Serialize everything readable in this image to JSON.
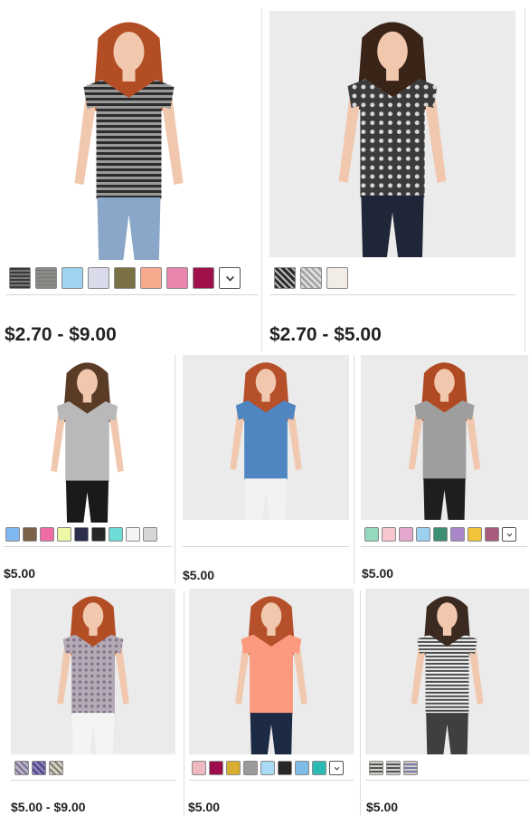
{
  "products": [
    {
      "id": "p1",
      "price": "$2.70 - $9.00",
      "swatches": [
        {
          "color": "#3a3a3a",
          "pattern": "stripe",
          "stripe": "#777"
        },
        {
          "color": "#8c8a86",
          "pattern": "heather",
          "stripe": "#777"
        },
        {
          "color": "#9fd3ef"
        },
        {
          "color": "#d9dbeb"
        },
        {
          "color": "#7a7145"
        },
        {
          "color": "#f7a98e"
        },
        {
          "color": "#ea86ad"
        },
        {
          "color": "#a0114b"
        }
      ],
      "more": true
    },
    {
      "id": "p2",
      "price": "$2.70 - $5.00",
      "swatches": [
        {
          "color": "#2a2a2a",
          "pattern": "pattern",
          "stripe": "#bbb"
        },
        {
          "color": "#dcdcdc",
          "pattern": "pattern",
          "stripe": "#9a9a9a"
        },
        {
          "color": "#f1ede6"
        }
      ],
      "more": false
    },
    {
      "id": "p3",
      "price": "$5.00",
      "swatches": [
        {
          "color": "#7fb8f0"
        },
        {
          "color": "#7b6147"
        },
        {
          "color": "#f06ca4"
        },
        {
          "color": "#eef7a5"
        },
        {
          "color": "#2b2d4a"
        },
        {
          "color": "#272727"
        },
        {
          "color": "#6bdcd6"
        },
        {
          "color": "#f4f4f4"
        },
        {
          "color": "#d6d6d6"
        }
      ],
      "more": false
    },
    {
      "id": "p4",
      "price": "$5.00",
      "swatches": [],
      "more": false
    },
    {
      "id": "p5",
      "price": "$5.00",
      "swatches": [
        {
          "color": "#94d9bd"
        },
        {
          "color": "#f7c6cf"
        },
        {
          "color": "#e4a8cc"
        },
        {
          "color": "#9bd0ee"
        },
        {
          "color": "#3c8f74"
        },
        {
          "color": "#a987c9"
        },
        {
          "color": "#f0c33a"
        },
        {
          "color": "#a85b7c"
        }
      ],
      "more": true
    },
    {
      "id": "p6",
      "price": "$5.00 - $9.00",
      "swatches": [
        {
          "color": "#b9b3c9",
          "pattern": "pattern",
          "stripe": "#7a7090"
        },
        {
          "color": "#8b7fc0",
          "pattern": "pattern",
          "stripe": "#4b4580"
        },
        {
          "color": "#d4d2c6",
          "pattern": "pattern",
          "stripe": "#7f7d70"
        }
      ],
      "more": false
    },
    {
      "id": "p7",
      "price": "$5.00",
      "swatches": [
        {
          "color": "#efb9c0"
        },
        {
          "color": "#9c0f4a"
        },
        {
          "color": "#d9ad2e"
        },
        {
          "color": "#9b9b9b"
        },
        {
          "color": "#a8daf4"
        },
        {
          "color": "#272727"
        },
        {
          "color": "#7fbde8"
        },
        {
          "color": "#2fb9b4"
        }
      ],
      "more": true
    },
    {
      "id": "p8",
      "price": "$5.00",
      "swatches": [
        {
          "color": "#d6d4cc",
          "pattern": "stripe",
          "stripe": "#555"
        },
        {
          "color": "#cfcfcf",
          "pattern": "stripe",
          "stripe": "#555"
        },
        {
          "color": "#d8c9c2",
          "pattern": "stripe",
          "stripe": "#6d7fa8"
        }
      ],
      "more": false
    }
  ],
  "icons": {
    "more_colors": "chevron-down-icon"
  }
}
